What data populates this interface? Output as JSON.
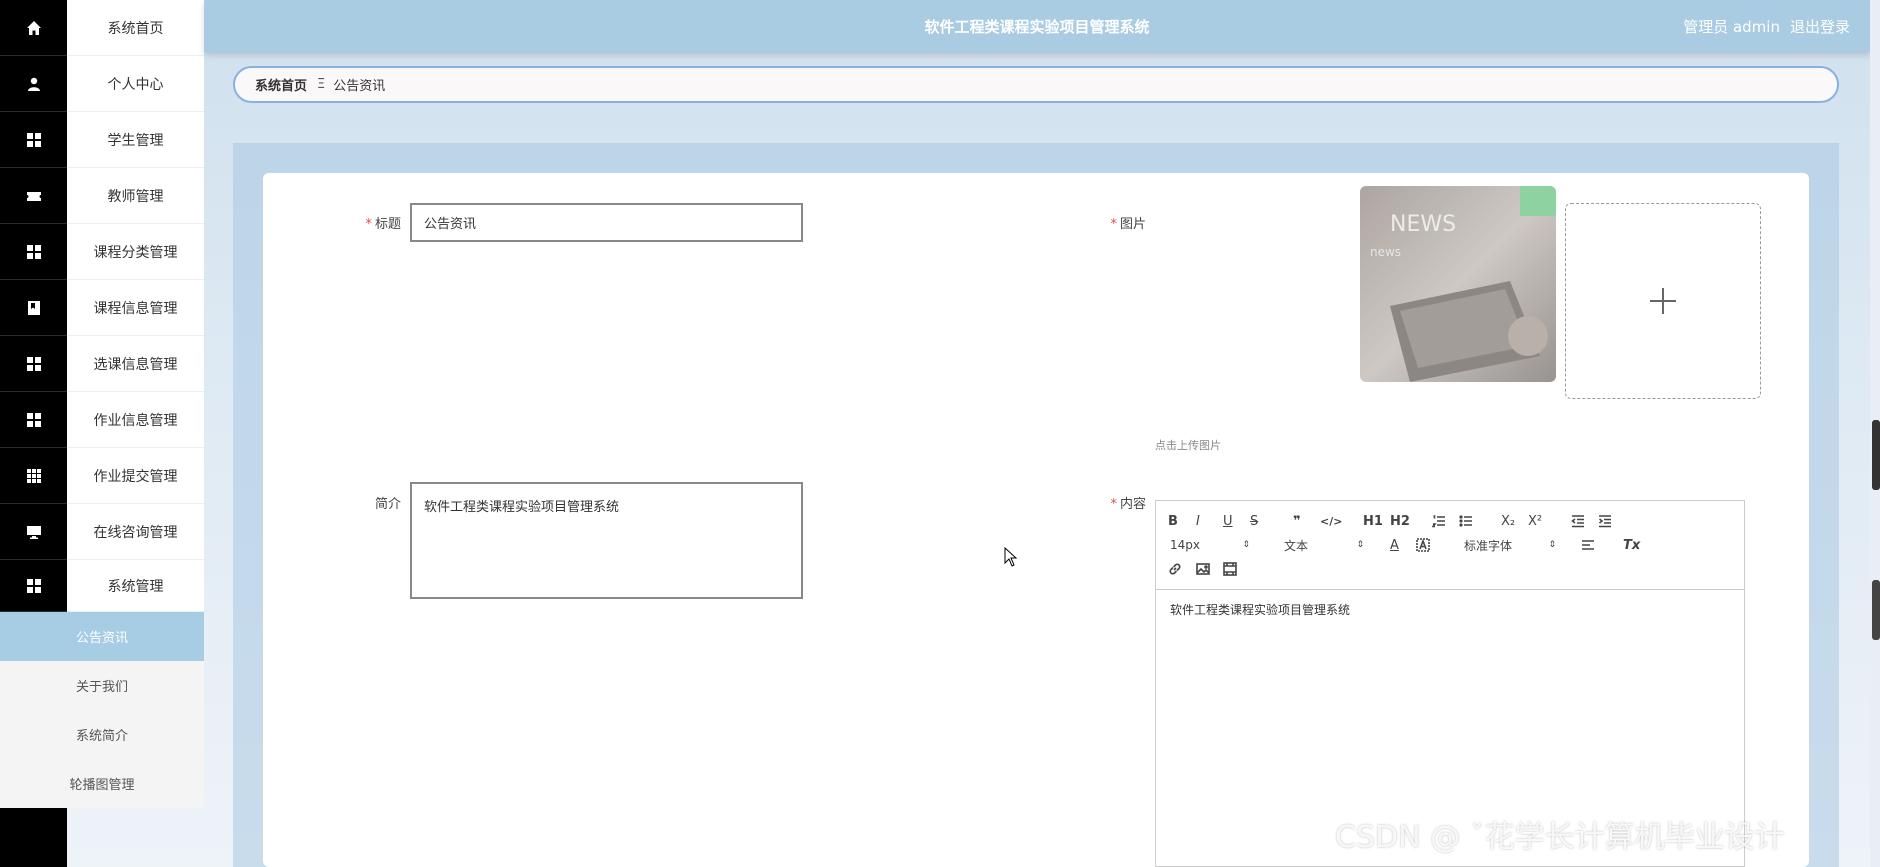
{
  "header": {
    "title": "软件工程类课程实验项目管理系统",
    "user": "管理员 admin",
    "logout": "退出登录"
  },
  "sidebar": {
    "items": [
      {
        "label": "系统首页",
        "icon": "home-icon"
      },
      {
        "label": "个人中心",
        "icon": "user-icon"
      },
      {
        "label": "学生管理",
        "icon": "grid-icon"
      },
      {
        "label": "教师管理",
        "icon": "ticket-icon"
      },
      {
        "label": "课程分类管理",
        "icon": "grid-icon"
      },
      {
        "label": "课程信息管理",
        "icon": "book-icon"
      },
      {
        "label": "选课信息管理",
        "icon": "grid-icon"
      },
      {
        "label": "作业信息管理",
        "icon": "grid-icon"
      },
      {
        "label": "作业提交管理",
        "icon": "table-icon"
      },
      {
        "label": "在线咨询管理",
        "icon": "monitor-icon"
      },
      {
        "label": "系统管理",
        "icon": "grid-icon"
      }
    ],
    "submenu": [
      {
        "label": "公告资讯",
        "active": true
      },
      {
        "label": "关于我们",
        "active": false
      },
      {
        "label": "系统简介",
        "active": false
      },
      {
        "label": "轮播图管理",
        "active": false
      }
    ]
  },
  "breadcrumb": {
    "home": "系统首页",
    "separator": "Ξ",
    "current": "公告资讯"
  },
  "form": {
    "title_label": "标题",
    "title_value": "公告资讯",
    "image_label": "图片",
    "upload_tip": "点击上传图片",
    "summary_label": "简介",
    "summary_value": "软件工程类课程实验项目管理系统",
    "content_label": "内容",
    "required_mark": "*"
  },
  "editor": {
    "font_size": "14px",
    "heading": "文本",
    "font_family": "标准字体",
    "body_text": "软件工程类课程实验项目管理系统",
    "buttons": [
      "B",
      "I",
      "U",
      "S",
      "❞",
      "</>",
      "H1",
      "H2",
      "ordered-list",
      "bullet-list",
      "X₂",
      "X²",
      "outdent",
      "indent",
      "A",
      "A-bg",
      "align",
      "Tx",
      "link",
      "image",
      "video"
    ]
  },
  "watermark": "CSDN @ ˇ花学长计算机毕业设计",
  "colors": {
    "header_bg": "#a9cce3",
    "sidebar_rail": "#000000",
    "submenu_active": "#a7cde4",
    "required": "#e04b4b",
    "breadcrumb_border": "#8ab0e0"
  }
}
